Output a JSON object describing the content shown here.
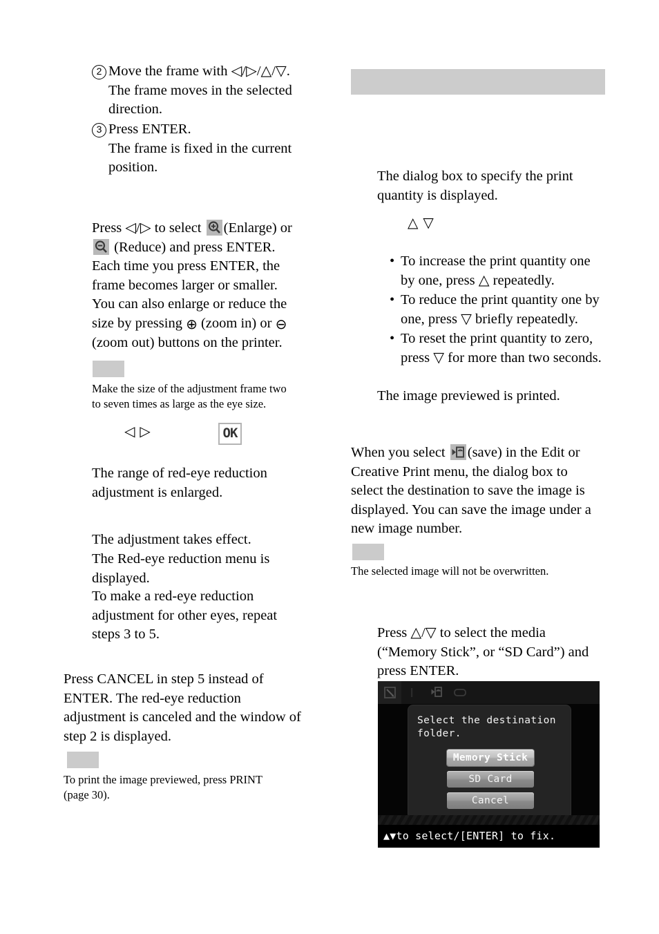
{
  "page": {
    "left_column": {
      "steps": [
        {
          "number": "2",
          "title": "Move the frame with ◁/▷/△/▽.",
          "detail_lines": [
            "The frame moves in the selected",
            "direction."
          ]
        },
        {
          "number": "3",
          "title": "Press ENTER.",
          "detail_lines": [
            "The frame is fixed in the current",
            "position."
          ]
        }
      ],
      "enlarge_paragraph": {
        "lead_1": "Press ◁/▷ to select",
        "enlarge_label": "(Enlarge) or",
        "reduce_label": "(Reduce) and press ENTER.",
        "line_3": "Each time you press ENTER, the",
        "line_4": "frame becomes larger or smaller.",
        "line_5": "You can also enlarge or reduce the",
        "line_6a": "size by pressing",
        "zoom_in_label": "(zoom in)  or",
        "line_7": "(zoom out) buttons on the printer."
      },
      "note_1": {
        "label": "",
        "lines": [
          "Make the size of the adjustment frame two",
          "to seven times as large as the eye size."
        ]
      },
      "symbol_row": {
        "arrows": "◁ ▷",
        "ok_label": "OK"
      },
      "result_1": [
        "The range of red-eye reduction",
        "adjustment is enlarged."
      ],
      "result_2": [
        "The adjustment takes effect."
      ],
      "result_3": [
        "The Red-eye reduction menu is",
        "displayed."
      ],
      "result_4": [
        "To make a red-eye reduction",
        "adjustment for other eyes, repeat",
        "steps 3 to 5."
      ],
      "cancel_paragraph": [
        "Press CANCEL in step 5 instead of",
        "ENTER.  The red-eye reduction",
        "adjustment is canceled and the window of",
        "step 2 is displayed."
      ],
      "note_2": {
        "label": "",
        "lines": [
          "To print the image previewed, press PRINT",
          "(page 30)."
        ]
      }
    },
    "right_column": {
      "header_bar": {
        "label": ""
      },
      "dialog_paragraph": [
        "The dialog box to specify the print",
        "quantity is displayed."
      ],
      "updown_arrows": "△ ▽",
      "quantity_bullets": [
        [
          "To increase the print quantity one",
          "by one, press △ repeatedly."
        ],
        [
          "To reduce the print quantity one by",
          "one, press ▽ briefly repeatedly."
        ],
        [
          "To reset the print quantity to zero,",
          "press ▽ for more than two seconds."
        ]
      ],
      "printed_line": "The image previewed is printed.",
      "save_paragraph": {
        "lead": "When you select",
        "after_icon": "(save) in the Edit or",
        "lines": [
          "Creative Print menu, the dialog box to",
          "select the destination to save the image is",
          "displayed. You can save the image under a",
          "new image number."
        ]
      },
      "note_3": {
        "label": "",
        "lines": [
          "The selected image will not be overwritten."
        ]
      },
      "media_paragraph": [
        "Press △/▽ to select the media",
        "(“Memory Stick”,  or “SD Card”) and",
        "press ENTER."
      ],
      "lcd_screen": {
        "message_lines": [
          "Select the destination",
          "folder."
        ],
        "buttons": [
          {
            "label": "Memory Stick",
            "selected": true
          },
          {
            "label": "SD Card",
            "selected": false
          },
          {
            "label": "Cancel",
            "selected": false
          }
        ],
        "status_bar": "▲▼to select/[ENTER] to fix."
      }
    }
  },
  "colors": {
    "note_chip": "#cbcbcb",
    "header_bar": "#cccccc",
    "icon_chip": "#b8b8b8",
    "lcd_background": "#050505",
    "lcd_dialog": "#242424",
    "lcd_button": "#9a9a9a",
    "lcd_button_selected": "#c2c2c2",
    "text": "#000000"
  }
}
